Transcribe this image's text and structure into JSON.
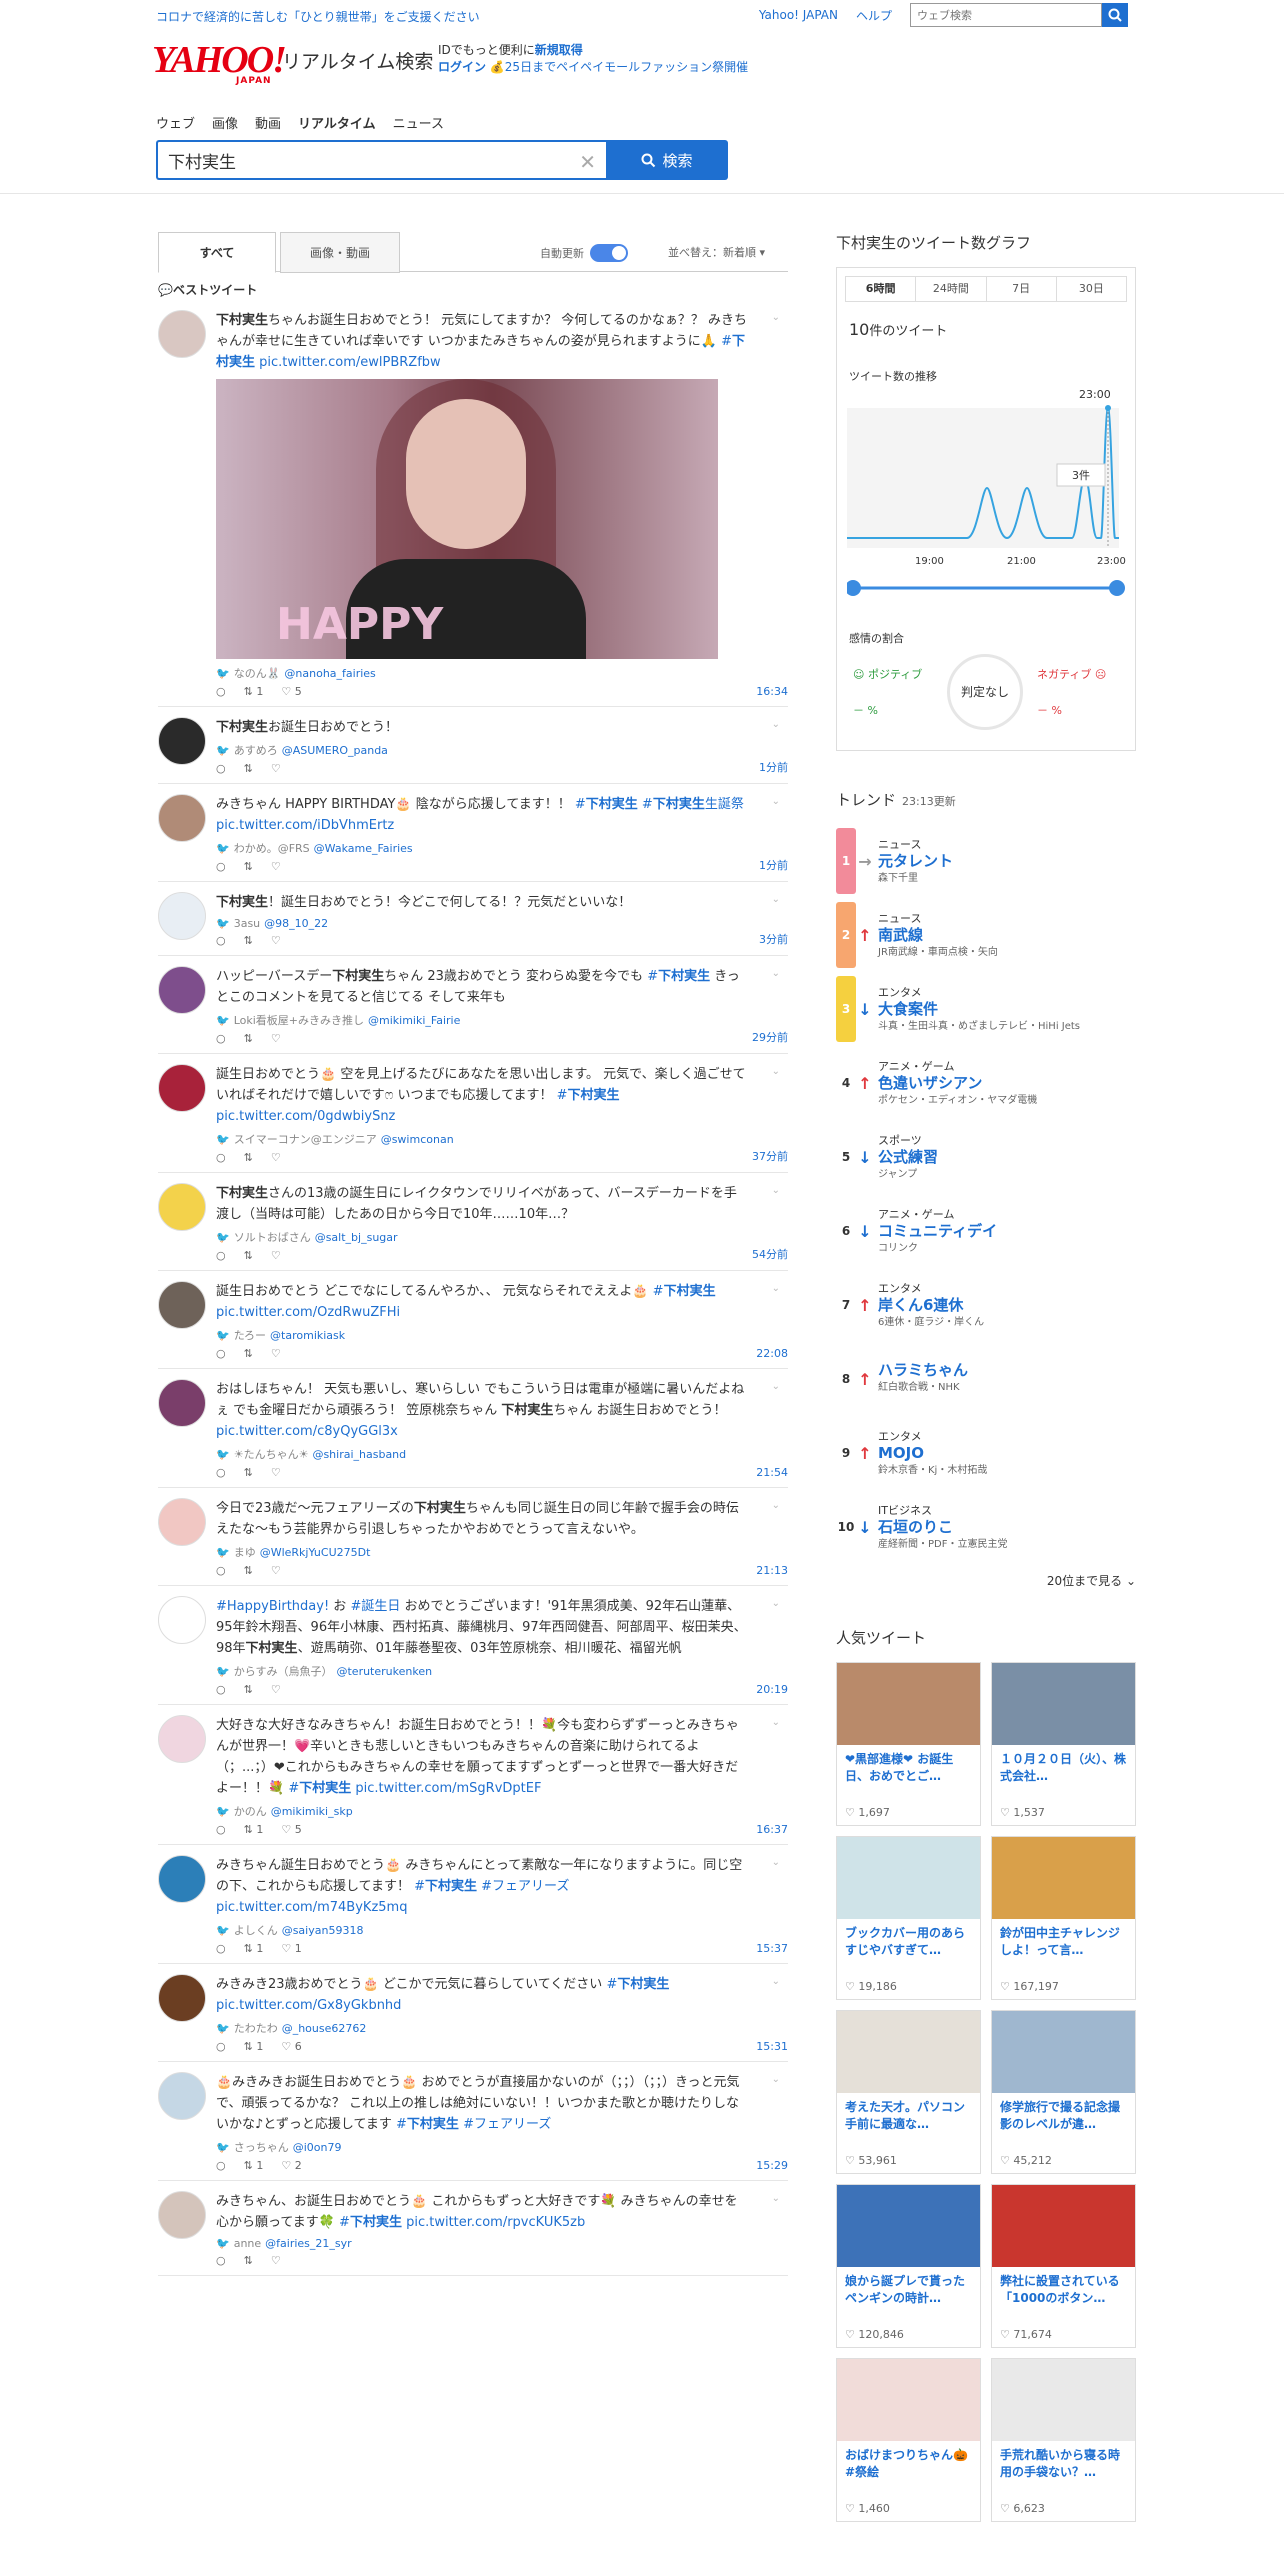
{
  "topbar": {
    "notice": "コロナで経済的に苦しむ「ひとり親世帯」をご支援ください",
    "yahoo_link": "Yahoo! JAPAN",
    "help_link": "ヘルプ",
    "web_search_placeholder": "ウェブ検索"
  },
  "header": {
    "logo": "YAHOO!",
    "logo_sub": "JAPAN",
    "service": "リアルタイム検索",
    "id_promo_1": "IDでもっと便利に",
    "id_promo_link": "新規取得",
    "login": "ログイン",
    "promo_2": "25日までペイペイモールファッション祭開催"
  },
  "nav": [
    "ウェブ",
    "画像",
    "動画",
    "リアルタイム",
    "ニュース"
  ],
  "search": {
    "query": "下村実生",
    "button": "検索"
  },
  "tabs": {
    "all": "すべて",
    "media": "画像・動画",
    "auto_update": "自動更新",
    "sort": "並べ替え：新着順 ▾"
  },
  "best_label": "ベストツイート",
  "tweets": [
    {
      "text": "下村実生ちゃんお誕生日おめでとう！ 元気にしてますか？ 今何してるのかなぁ？？ みきちゃんが幸せに生きていれば幸いです いつかまたみきちゃんの姿が見られますように🙏 #下村実生 pic.twitter.com/ewlPBRZfbw",
      "user": "なのん🐰",
      "handle": "@nanoha_fairies",
      "rt": "1",
      "like": "5",
      "time": "16:34",
      "photo": true,
      "avatar": "#d9c7c2"
    },
    {
      "text": "下村実生お誕生日おめでとう！",
      "user": "あすめろ",
      "handle": "@ASUMERO_panda",
      "rt": "",
      "like": "",
      "time": "1分前",
      "avatar": "#2a2a2a"
    },
    {
      "text": "みきちゃん HAPPY BIRTHDAY🎂 陰ながら応援してます！！ #下村実生 #下村実生生誕祭 pic.twitter.com/iDbVhmErtz",
      "user": "わかめ。@FRS",
      "handle": "@Wakame_Fairies",
      "rt": "",
      "like": "",
      "time": "1分前",
      "avatar": "#b08b77"
    },
    {
      "text": "下村実生！誕生日おめでとう！今どこで何してる！？元気だといいな！",
      "user": "3asu",
      "handle": "@98_10_22",
      "rt": "",
      "like": "",
      "time": "3分前",
      "avatar": "#e8eef4"
    },
    {
      "text": "ハッピーバースデー下村実生ちゃん 23歳おめでとう 変わらぬ愛を今でも #下村実生 きっとこのコメントを見てると信じてる そして来年も",
      "user": "Loki看板屋+みきみき推し",
      "handle": "@mikimiki_Fairie",
      "rt": "",
      "like": "",
      "time": "29分前",
      "avatar": "#7e4e8c"
    },
    {
      "text": "誕生日おめでとう🎂 空を見上げるたびにあなたを思い出します。 元気で、楽しく過ごせていればそれだけで嬉しいですෆ いつまでも応援してます！ #下村実生 pic.twitter.com/0gdwbiySnz",
      "user": "スイマーコナン@エンジニア",
      "handle": "@swimconan",
      "rt": "",
      "like": "",
      "time": "37分前",
      "avatar": "#a8223a"
    },
    {
      "text": "下村実生さんの13歳の誕生日にレイクタウンでリリイベがあって、バースデーカードを手渡し（当時は可能）したあの日から今日で10年……10年…？",
      "user": "ソルトおばさん",
      "handle": "@salt_bj_sugar",
      "rt": "",
      "like": "",
      "time": "54分前",
      "avatar": "#f3d24b"
    },
    {
      "text": "誕生日おめでとう どこでなにしてるんやろか、、 元気ならそれでええよ🎂 #下村実生 pic.twitter.com/OzdRwuZFHi",
      "user": "たろー",
      "handle": "@taromikiask",
      "rt": "",
      "like": "",
      "time": "22:08",
      "avatar": "#6e6259"
    },
    {
      "text": "おはしほちゃん！ 天気も悪いし、寒いらしい でもこういう日は電車が極端に暑いんだよねぇ でも金曜日だから頑張ろう！ 笠原桃奈ちゃん 下村実生ちゃん お誕生日おめでとう！ pic.twitter.com/c8yQyGGl3x",
      "user": "☀たんちゃん☀",
      "handle": "@shirai_hasband",
      "rt": "",
      "like": "",
      "time": "21:54",
      "avatar": "#7a3e6a"
    },
    {
      "text": "今日で23歳だ〜元フェアリーズの下村実生ちゃんも同じ誕生日の同じ年齢で握手会の時伝えたな〜もう芸能界から引退しちゃったかやおめでとうって言えないや。",
      "user": "まゆ",
      "handle": "@WleRkjYuCU275Dt",
      "rt": "",
      "like": "",
      "time": "21:13",
      "avatar": "#f1c7c3"
    },
    {
      "text": "#HappyBirthday! お #誕生日 おめでとうございます！'91年黒須成美、92年石山蓮華、95年鈴木翔吾、96年小林康、西村拓真、藤縄桃月、97年西岡健吾、阿部周平、桜田茉央、98年下村実生、遊馬萌弥、01年藤巻聖夜、03年笠原桃奈、相川暖花、福留光帆",
      "user": "からすみ（烏魚子）",
      "handle": "@teruterukenken",
      "rt": "",
      "like": "",
      "time": "20:19",
      "avatar": "#ffffff"
    },
    {
      "text": "大好きな大好きなみきちゃん！お誕生日おめでとう！！💐今も変わらずずーっとみきちゃんが世界一！💗辛いときも悲しいときもいつもみきちゃんの音楽に助けられてるよ（；...；）❤これからもみきちゃんの幸せを願ってますずっとずーっと世界で一番大好きだよー！！💐 #下村実生 pic.twitter.com/mSgRvDptEF",
      "user": "かのん",
      "handle": "@mikimiki_skp",
      "rt": "1",
      "like": "5",
      "time": "16:37",
      "avatar": "#f0d6e0"
    },
    {
      "text": "みきちゃん誕生日おめでとう🎂 みきちゃんにとって素敵な一年になりますように。同じ空の下、これからも応援してます！ #下村実生 #フェアリーズ pic.twitter.com/m74ByKz5mq",
      "user": "よしくん",
      "handle": "@saiyan59318",
      "rt": "1",
      "like": "1",
      "time": "15:37",
      "avatar": "#2c7fb8"
    },
    {
      "text": "みきみき23歳おめでとう🎂 どこかで元気に暮らしていてください #下村実生 pic.twitter.com/Gx8yGkbnhd",
      "user": "たわたわ",
      "handle": "@_house62762",
      "rt": "1",
      "like": "6",
      "time": "15:31",
      "avatar": "#6b3e22"
    },
    {
      "text": "🎂みきみきお誕生日おめでとう🎂 おめでとうが直接届かないのが（；；）（；；）きっと元気で、頑張ってるかな？ これ以上の推しは絶対にいない！！いつかまた歌とか聴けたりしないかな♪とずっと応援してます #下村実生 #フェアリーズ",
      "user": "さっちゃん",
      "handle": "@i0on79",
      "rt": "1",
      "like": "2",
      "time": "15:29",
      "avatar": "#c5d7e5"
    },
    {
      "text": "みきちゃん、お誕生日おめでとう🎂 これからもずっと大好きです💐 みきちゃんの幸せを心から願ってます🍀 #下村実生 pic.twitter.com/rpvcKUK5zb",
      "user": "anne",
      "handle": "@fairies_21_syr",
      "rt": "",
      "like": "",
      "time": "",
      "avatar": "#d4c4bb"
    }
  ],
  "graph": {
    "title": "下村実生のツイート数グラフ",
    "tabs": [
      "6時間",
      "24時間",
      "7日",
      "30日"
    ],
    "count_prefix": "10",
    "count_suffix": "件のツイート",
    "chart_label": "ツイート数の推移",
    "peak_time": "23:00",
    "peak_label": "3件",
    "ticks": [
      "19:00",
      "21:00",
      "23:00"
    ],
    "emotion_title": "感情の割合",
    "positive": "ポジティブ",
    "negative": "ネガティブ",
    "positive_val": "－ %",
    "negative_val": "－ %",
    "judgement": "判定なし"
  },
  "chart_data": {
    "type": "line",
    "x": [
      "17:00",
      "18:00",
      "19:00",
      "20:00",
      "21:00",
      "22:00",
      "23:00"
    ],
    "ticks": [
      "19:00",
      "21:00",
      "23:00"
    ],
    "ylabel": "",
    "xlabel": ""
  },
  "trend": {
    "title": "トレンド",
    "updated": "23:13更新",
    "more": "20位まで見る ⌄",
    "items": [
      {
        "rank": "1",
        "cat": "ニュース",
        "word": "元タレント",
        "rel": "森下千里",
        "dir": "side",
        "color": "#f28b9a"
      },
      {
        "rank": "2",
        "cat": "ニュース",
        "word": "南武線",
        "rel": "JR南武線・車両点検・矢向",
        "dir": "up",
        "color": "#f7a66f"
      },
      {
        "rank": "3",
        "cat": "エンタメ",
        "word": "大食案件",
        "rel": "斗真・生田斗真・めざましテレビ・HiHi Jets",
        "dir": "down",
        "color": "#f5d03f"
      },
      {
        "rank": "4",
        "cat": "アニメ・ゲーム",
        "word": "色違いザシアン",
        "rel": "ポケセン・エディオン・ヤマダ電機",
        "dir": "up",
        "color": ""
      },
      {
        "rank": "5",
        "cat": "スポーツ",
        "word": "公式練習",
        "rel": "ジャンプ",
        "dir": "down",
        "color": ""
      },
      {
        "rank": "6",
        "cat": "アニメ・ゲーム",
        "word": "コミュニティデイ",
        "rel": "コリンク",
        "dir": "down",
        "color": ""
      },
      {
        "rank": "7",
        "cat": "エンタメ",
        "word": "岸くん6連休",
        "rel": "6連休・庭ラジ・岸くん",
        "dir": "up",
        "color": ""
      },
      {
        "rank": "8",
        "cat": "",
        "word": "ハラミちゃん",
        "rel": "紅白歌合戦・NHK",
        "dir": "up",
        "color": ""
      },
      {
        "rank": "9",
        "cat": "エンタメ",
        "word": "MOJO",
        "rel": "鈴木京香・Kj・木村拓哉",
        "dir": "up",
        "color": ""
      },
      {
        "rank": "10",
        "cat": "ITビジネス",
        "word": "石垣のりこ",
        "rel": "産経新聞・PDF・立憲民主党",
        "dir": "down",
        "color": ""
      }
    ]
  },
  "popular": {
    "title": "人気ツイート",
    "items": [
      {
        "text": "❤黒部進様❤ お誕生日、おめでとご…",
        "likes": "1,697",
        "img": "#b98a6a"
      },
      {
        "text": "１０月２０日（火）、株式会社…",
        "likes": "1,537",
        "img": "#7a8fa6"
      },
      {
        "text": "ブックカバー用のあらすじやバすぎて…",
        "likes": "19,186",
        "img": "#cfe3e8"
      },
      {
        "text": "鈴が田中主チャレンジしよ！って言…",
        "likes": "167,197",
        "img": "#d9a04a"
      },
      {
        "text": "考えた天才。パソコン手前に最適な…",
        "likes": "53,961",
        "img": "#e5e0d8"
      },
      {
        "text": "修学旅行で撮る記念撮影のレベルが違…",
        "likes": "45,212",
        "img": "#9fb7cf"
      },
      {
        "text": "娘から誕プレで貰ったペンギンの時計…",
        "likes": "120,846",
        "img": "#3d72b8"
      },
      {
        "text": "弊社に設置されている「1000のボタン…",
        "likes": "71,674",
        "img": "#c9362e"
      },
      {
        "text": "おばけまつりちゃん🎃 #祭絵",
        "likes": "1,460",
        "img": "#f1dcd9"
      },
      {
        "text": "手荒れ酷いから寝る時用の手袋ない？…",
        "likes": "6,623",
        "img": "#e9e9e9"
      }
    ]
  }
}
